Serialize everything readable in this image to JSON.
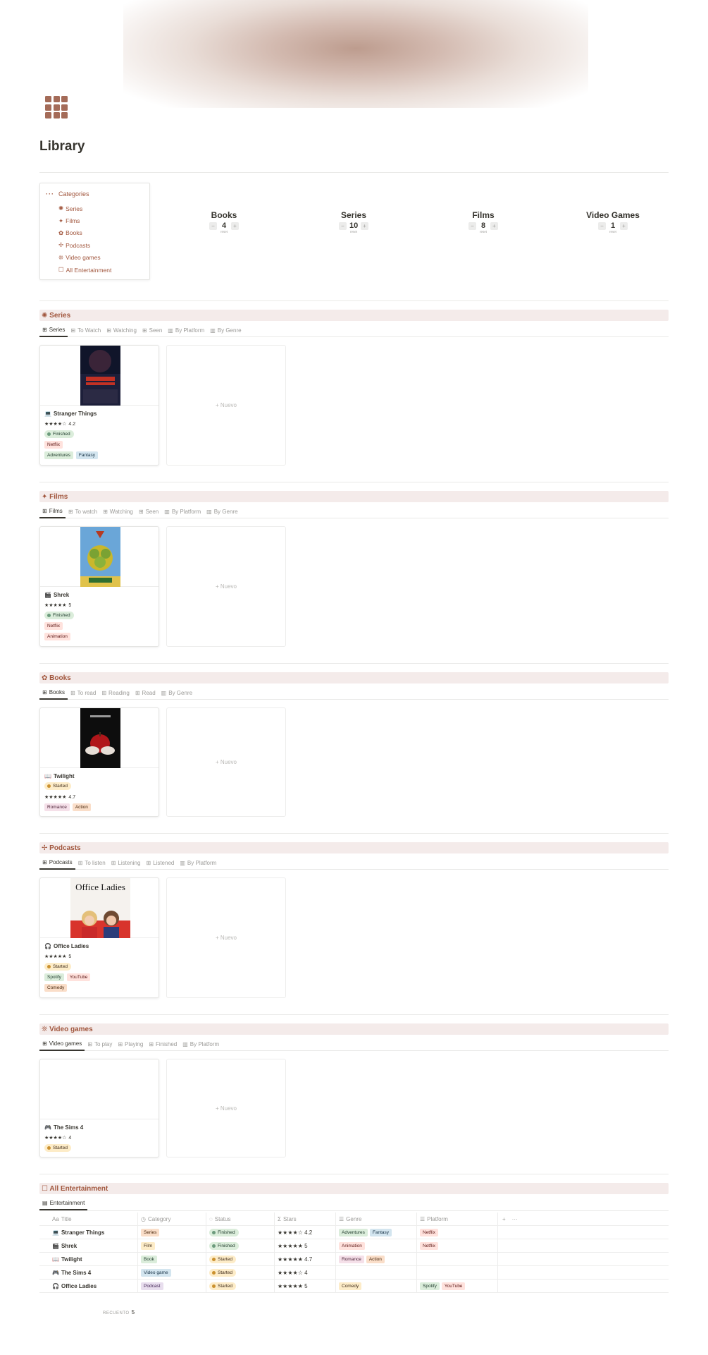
{
  "page": {
    "title": "Library"
  },
  "categories": {
    "heading": "Categories",
    "items": [
      {
        "icon": "✺",
        "label": "Series"
      },
      {
        "icon": "✦",
        "label": "Films"
      },
      {
        "icon": "✿",
        "label": "Books"
      },
      {
        "icon": "✢",
        "label": "Podcasts"
      },
      {
        "icon": "❊",
        "label": "Video games"
      },
      {
        "icon": "☐",
        "label": "All Entertainment"
      }
    ]
  },
  "counters": [
    {
      "title": "Books",
      "value": "4",
      "minus": "−",
      "plus": "+",
      "reset": "reset"
    },
    {
      "title": "Series",
      "value": "10",
      "minus": "−",
      "plus": "+",
      "reset": "reset"
    },
    {
      "title": "Films",
      "value": "8",
      "minus": "−",
      "plus": "+",
      "reset": "reset"
    },
    {
      "title": "Video Games",
      "value": "1",
      "minus": "−",
      "plus": "+",
      "reset": "reset"
    }
  ],
  "sections": {
    "series": {
      "header": "✺ Series",
      "tabs": [
        "Series",
        "To Watch",
        "Watching",
        "Seen",
        "By Platform",
        "By Genre"
      ],
      "card": {
        "icon": "💻",
        "title": "Stranger Things",
        "stars": "★★★★☆",
        "rating": "4.2",
        "status": "Finished",
        "platforms": [
          "Netflix"
        ],
        "genres": [
          "Adventures",
          "Fantasy"
        ]
      }
    },
    "films": {
      "header": "✦ Films",
      "tabs": [
        "Films",
        "To watch",
        "Watching",
        "Seen",
        "By Platform",
        "By Genre"
      ],
      "card": {
        "icon": "🎬",
        "title": "Shrek",
        "stars": "★★★★★",
        "rating": "5",
        "status": "Finished",
        "platforms": [
          "Netflix"
        ],
        "genres": [
          "Animation"
        ]
      }
    },
    "books": {
      "header": "✿ Books",
      "tabs": [
        "Books",
        "To read",
        "Reading",
        "Read",
        "By Genre"
      ],
      "card": {
        "icon": "📖",
        "title": "Twilight",
        "stars": "★★★★★",
        "rating": "4.7",
        "status": "Started",
        "genres": [
          "Romance",
          "Action"
        ]
      }
    },
    "podcasts": {
      "header": "✢ Podcasts",
      "tabs": [
        "Podcasts",
        "To listen",
        "Listening",
        "Listened",
        "By Platform"
      ],
      "card": {
        "icon": "🎧",
        "title": "Office Ladies",
        "stars": "★★★★★",
        "rating": "5",
        "status": "Started",
        "platforms": [
          "Spotify",
          "YouTube"
        ],
        "genres": [
          "Comedy"
        ],
        "cover_text": "Office Ladies"
      }
    },
    "videogames": {
      "header": "❊ Video games",
      "tabs": [
        "Video games",
        "To play",
        "Playing",
        "Finished",
        "By Platform"
      ],
      "card": {
        "icon": "🎮",
        "title": "The Sims 4",
        "stars": "★★★★☆",
        "rating": "4",
        "status": "Started"
      }
    },
    "all": {
      "header": "☐ All Entertainment",
      "tab": "Entertainment"
    }
  },
  "new_label": "+ Nuevo",
  "table": {
    "columns": [
      "Title",
      "Category",
      "Status",
      "Stars",
      "Genre",
      "Platform"
    ],
    "column_icons": [
      "Aa",
      "◷",
      "◌",
      "Σ",
      "☰",
      "☰"
    ],
    "add": "+",
    "more": "···",
    "rows": [
      {
        "icon": "💻",
        "title": "Stranger Things",
        "category": "Series",
        "status": "Finished",
        "stars": "★★★★☆ 4.2",
        "genres": [
          "Adventures",
          "Fantasy"
        ],
        "platforms": [
          "Netflix"
        ]
      },
      {
        "icon": "🎬",
        "title": "Shrek",
        "category": "Film",
        "status": "Finished",
        "stars": "★★★★★ 5",
        "genres": [
          "Animation"
        ],
        "platforms": [
          "Netflix"
        ]
      },
      {
        "icon": "📖",
        "title": "Twilight",
        "category": "Book",
        "status": "Started",
        "stars": "★★★★★ 4.7",
        "genres": [
          "Romance",
          "Action"
        ],
        "platforms": []
      },
      {
        "icon": "🎮",
        "title": "The Sims 4",
        "category": "Video game",
        "status": "Started",
        "stars": "★★★★☆ 4",
        "genres": [],
        "platforms": []
      },
      {
        "icon": "🎧",
        "title": "Office Ladies",
        "category": "Podcast",
        "status": "Started",
        "stars": "★★★★★ 5",
        "genres": [
          "Comedy"
        ],
        "platforms": [
          "Spotify",
          "YouTube"
        ]
      }
    ],
    "count_label": "RECUENTO",
    "count_value": "5"
  },
  "colors": {
    "accent": "#a1563d",
    "section_bg": "#f4ebea",
    "icon": "#a46b58"
  }
}
